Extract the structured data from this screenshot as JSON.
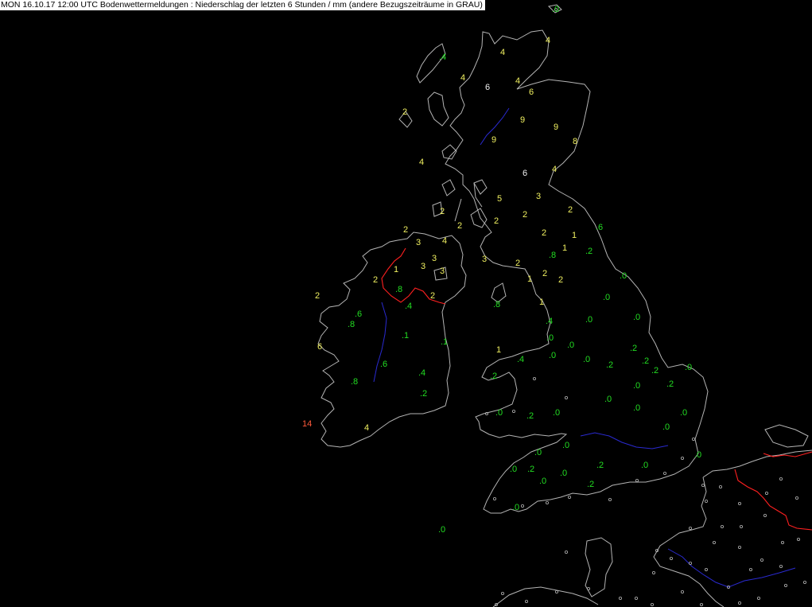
{
  "header": {
    "title": "MON 16.10.17 12:00 UTC  Bodenwettermeldungen :  Niederschlag der letzten 6 Stunden  / mm (andere Bezugszeiträume in GRAU)"
  },
  "colors": {
    "background": "#000000",
    "coastline": "#b4b4b4",
    "border": "#ff2020",
    "river": "#2a2ad0",
    "trace": "#22dd22",
    "light": "#f0f060",
    "moderate": "#f0f0f0",
    "heavy": "#ff5a3c"
  },
  "observations": [
    {
      "value": ".0",
      "cls": "trace"
    },
    {
      "value": "4",
      "cls": "light"
    },
    {
      "value": "4",
      "cls": "light"
    },
    {
      "value": ".4",
      "cls": "trace"
    },
    {
      "value": "4",
      "cls": "light"
    },
    {
      "value": "6",
      "cls": "moderate"
    },
    {
      "value": "4",
      "cls": "light"
    },
    {
      "value": "6",
      "cls": "light"
    },
    {
      "value": "2",
      "cls": "light"
    },
    {
      "value": "9",
      "cls": "light"
    },
    {
      "value": "9",
      "cls": "light"
    },
    {
      "value": "9",
      "cls": "light"
    },
    {
      "value": "8",
      "cls": "light"
    },
    {
      "value": "4",
      "cls": "light"
    },
    {
      "value": "6",
      "cls": "moderate"
    },
    {
      "value": "4",
      "cls": "light"
    },
    {
      "value": "5",
      "cls": "light"
    },
    {
      "value": "3",
      "cls": "light"
    },
    {
      "value": "2",
      "cls": "light"
    },
    {
      "value": "2",
      "cls": "light"
    },
    {
      "value": "2",
      "cls": "light"
    },
    {
      "value": "2",
      "cls": "light"
    },
    {
      "value": "2",
      "cls": "light"
    },
    {
      "value": "2",
      "cls": "light"
    },
    {
      "value": "3",
      "cls": "light"
    },
    {
      "value": "4",
      "cls": "light"
    },
    {
      "value": "2",
      "cls": "light"
    },
    {
      "value": "1",
      "cls": "light"
    },
    {
      "value": ".6",
      "cls": "trace"
    },
    {
      "value": "1",
      "cls": "light"
    },
    {
      "value": "3",
      "cls": "light"
    },
    {
      "value": "3",
      "cls": "light"
    },
    {
      "value": "3",
      "cls": "light"
    },
    {
      "value": "3",
      "cls": "light"
    },
    {
      "value": "2",
      "cls": "light"
    },
    {
      "value": ".2",
      "cls": "trace"
    },
    {
      "value": ".8",
      "cls": "trace"
    },
    {
      "value": "2",
      "cls": "light"
    },
    {
      "value": "1",
      "cls": "light"
    },
    {
      "value": "2",
      "cls": "light"
    },
    {
      "value": "1",
      "cls": "light"
    },
    {
      "value": "2",
      "cls": "light"
    },
    {
      "value": ".8",
      "cls": "trace"
    },
    {
      "value": ".4",
      "cls": "trace"
    },
    {
      "value": "2",
      "cls": "light"
    },
    {
      "value": "1",
      "cls": "light"
    },
    {
      "value": ".0",
      "cls": "trace"
    },
    {
      "value": ".8",
      "cls": "trace"
    },
    {
      "value": ".0",
      "cls": "trace"
    },
    {
      "value": "2",
      "cls": "light"
    },
    {
      "value": ".6",
      "cls": "trace"
    },
    {
      "value": ".8",
      "cls": "trace"
    },
    {
      "value": ".4",
      "cls": "trace"
    },
    {
      "value": ".0",
      "cls": "trace"
    },
    {
      "value": ".0",
      "cls": "trace"
    },
    {
      "value": ".1",
      "cls": "trace"
    },
    {
      "value": ".1",
      "cls": "trace"
    },
    {
      "value": "6",
      "cls": "light"
    },
    {
      "value": ".0",
      "cls": "trace"
    },
    {
      "value": ".0",
      "cls": "trace"
    },
    {
      "value": "1",
      "cls": "light"
    },
    {
      "value": ".2",
      "cls": "trace"
    },
    {
      "value": ".4",
      "cls": "trace"
    },
    {
      "value": ".0",
      "cls": "trace"
    },
    {
      "value": ".0",
      "cls": "trace"
    },
    {
      "value": ".2",
      "cls": "trace"
    },
    {
      "value": ".6",
      "cls": "trace"
    },
    {
      "value": ".4",
      "cls": "trace"
    },
    {
      "value": ".2",
      "cls": "trace"
    },
    {
      "value": ".2",
      "cls": "trace"
    },
    {
      "value": ".0",
      "cls": "trace"
    },
    {
      "value": ".8",
      "cls": "trace"
    },
    {
      "value": ".2",
      "cls": "trace"
    },
    {
      "value": ".0",
      "cls": "trace"
    },
    {
      "value": ".2",
      "cls": "trace"
    },
    {
      "value": ".0",
      "cls": "trace"
    },
    {
      "value": ".2",
      "cls": "trace"
    },
    {
      "value": ".0",
      "cls": "trace"
    },
    {
      "value": ".2",
      "cls": "trace"
    },
    {
      "value": ".0",
      "cls": "trace"
    },
    {
      "value": ".0",
      "cls": "trace"
    },
    {
      "value": ".0",
      "cls": "trace"
    },
    {
      "value": "14",
      "cls": "heavy"
    },
    {
      "value": "4",
      "cls": "light"
    },
    {
      "value": ".0",
      "cls": "trace"
    },
    {
      "value": ".0",
      "cls": "trace"
    },
    {
      "value": ".0",
      "cls": "trace"
    },
    {
      "value": ".2",
      "cls": "trace"
    },
    {
      "value": ".0",
      "cls": "trace"
    },
    {
      "value": ".0",
      "cls": "trace"
    },
    {
      "value": ".0",
      "cls": "trace"
    },
    {
      "value": ".2",
      "cls": "trace"
    },
    {
      "value": ".0",
      "cls": "trace"
    },
    {
      "value": ".0",
      "cls": "trace"
    },
    {
      "value": ".2",
      "cls": "trace"
    },
    {
      "value": ".0",
      "cls": "trace"
    },
    {
      "value": ".0",
      "cls": "trace"
    },
    {
      "value": ".0",
      "cls": "trace"
    }
  ]
}
